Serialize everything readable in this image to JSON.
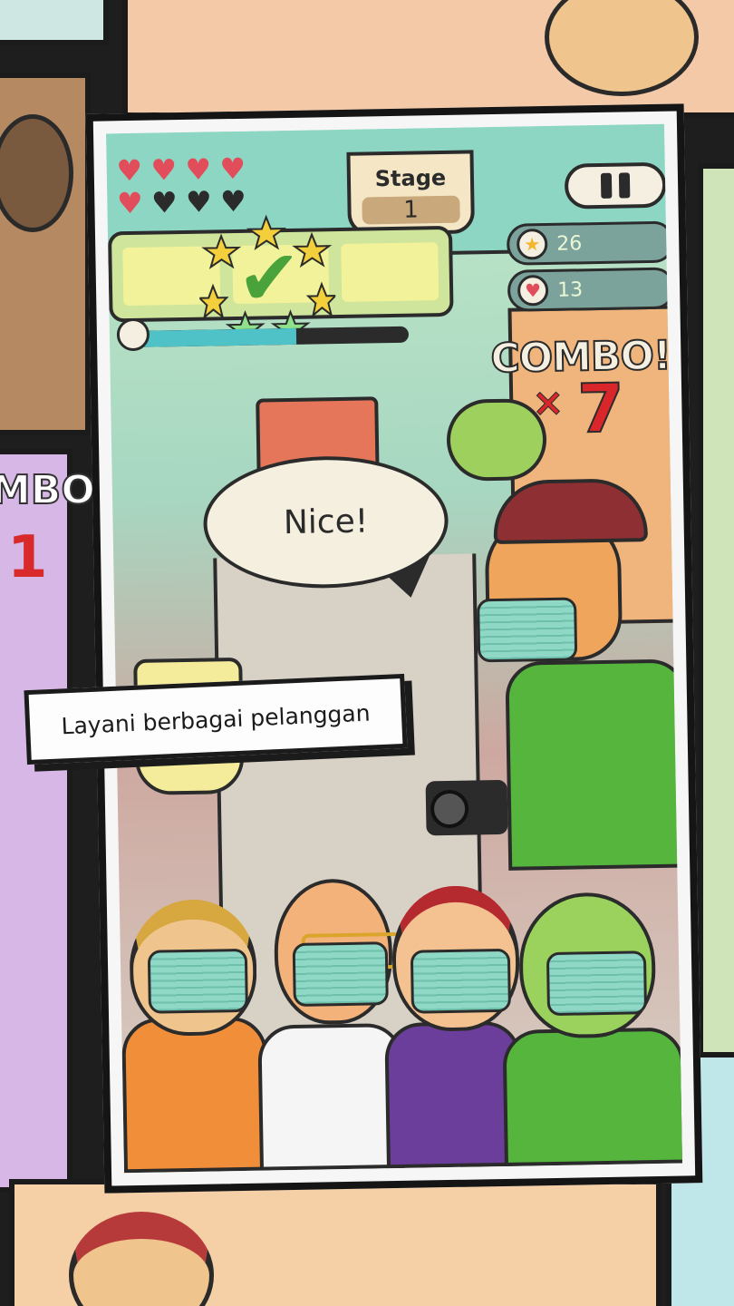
{
  "hud": {
    "hearts": {
      "total": 8,
      "filled": 4
    },
    "stage": {
      "label": "Stage",
      "number": "1"
    },
    "pause_icon": "pause-icon",
    "stars_count": "26",
    "hearts_count": "13",
    "timer_fraction": 0.6,
    "combo": {
      "label": "COMBO!",
      "multiplier_symbol": "×",
      "value": "7"
    }
  },
  "order": {
    "status_icon": "check-mark-icon",
    "check_glyph": "✔"
  },
  "dialogue": {
    "text": "Nice!"
  },
  "caption": {
    "text": "Layani berbagai pelanggan"
  },
  "background_panel": {
    "combo_fragment": "MBO",
    "combo_number": "1"
  },
  "colors": {
    "combo_red": "#d8262b",
    "mask_teal": "#8fd8c6",
    "heart_red": "#e14d5a",
    "star_gold": "#f2b52b"
  }
}
